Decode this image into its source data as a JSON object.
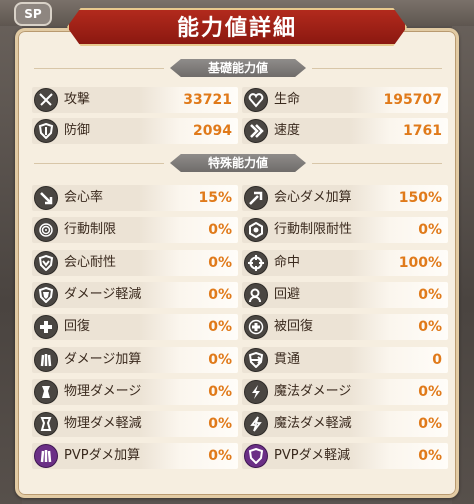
{
  "title": "能力値詳細",
  "top_badge": "SP",
  "basic_section": "基礎能力値",
  "special_section": "特殊能力値",
  "basic": [
    {
      "icon": "sword-cross-icon",
      "label": "攻撃",
      "value": "33721"
    },
    {
      "icon": "heart-icon",
      "label": "生命",
      "value": "195707"
    },
    {
      "icon": "shield-icon",
      "label": "防御",
      "value": "2094"
    },
    {
      "icon": "speed-chevron-icon",
      "label": "速度",
      "value": "1761"
    }
  ],
  "special": [
    {
      "icon": "critical-arrow-icon",
      "label": "会心率",
      "value": "15%"
    },
    {
      "icon": "critical-damage-icon",
      "label": "会心ダメ加算",
      "value": "150%"
    },
    {
      "icon": "spiral-icon",
      "label": "行動制限",
      "value": "0%"
    },
    {
      "icon": "hex-resist-icon",
      "label": "行動制限耐性",
      "value": "0%"
    },
    {
      "icon": "crit-resist-shield-icon",
      "label": "会心耐性",
      "value": "0%"
    },
    {
      "icon": "crosshair-icon",
      "label": "命中",
      "value": "100%"
    },
    {
      "icon": "damage-reduce-shield-icon",
      "label": "ダメージ軽減",
      "value": "0%"
    },
    {
      "icon": "dodge-icon",
      "label": "回避",
      "value": "0%"
    },
    {
      "icon": "heal-plus-icon",
      "label": "回復",
      "value": "0%"
    },
    {
      "icon": "received-heal-icon",
      "label": "被回復",
      "value": "0%"
    },
    {
      "icon": "claw-icon",
      "label": "ダメージ加算",
      "value": "0%"
    },
    {
      "icon": "pierce-icon",
      "label": "貫通",
      "value": "0"
    },
    {
      "icon": "physical-damage-icon",
      "label": "物理ダメージ",
      "value": "0%"
    },
    {
      "icon": "magic-bolt-icon",
      "label": "魔法ダメージ",
      "value": "0%"
    },
    {
      "icon": "physical-reduce-icon",
      "label": "物理ダメ軽減",
      "value": "0%"
    },
    {
      "icon": "magic-reduce-icon",
      "label": "魔法ダメ軽減",
      "value": "0%"
    },
    {
      "icon": "pvp-claw-icon",
      "label": "PVPダメ加算",
      "value": "0%",
      "accent": "#6b2f86"
    },
    {
      "icon": "pvp-shield-icon",
      "label": "PVPダメ軽減",
      "value": "0%",
      "accent": "#6b2f86"
    }
  ],
  "colors": {
    "value": "#e07a1a",
    "banner": "#b22a1d",
    "panel": "#f6eee0"
  }
}
